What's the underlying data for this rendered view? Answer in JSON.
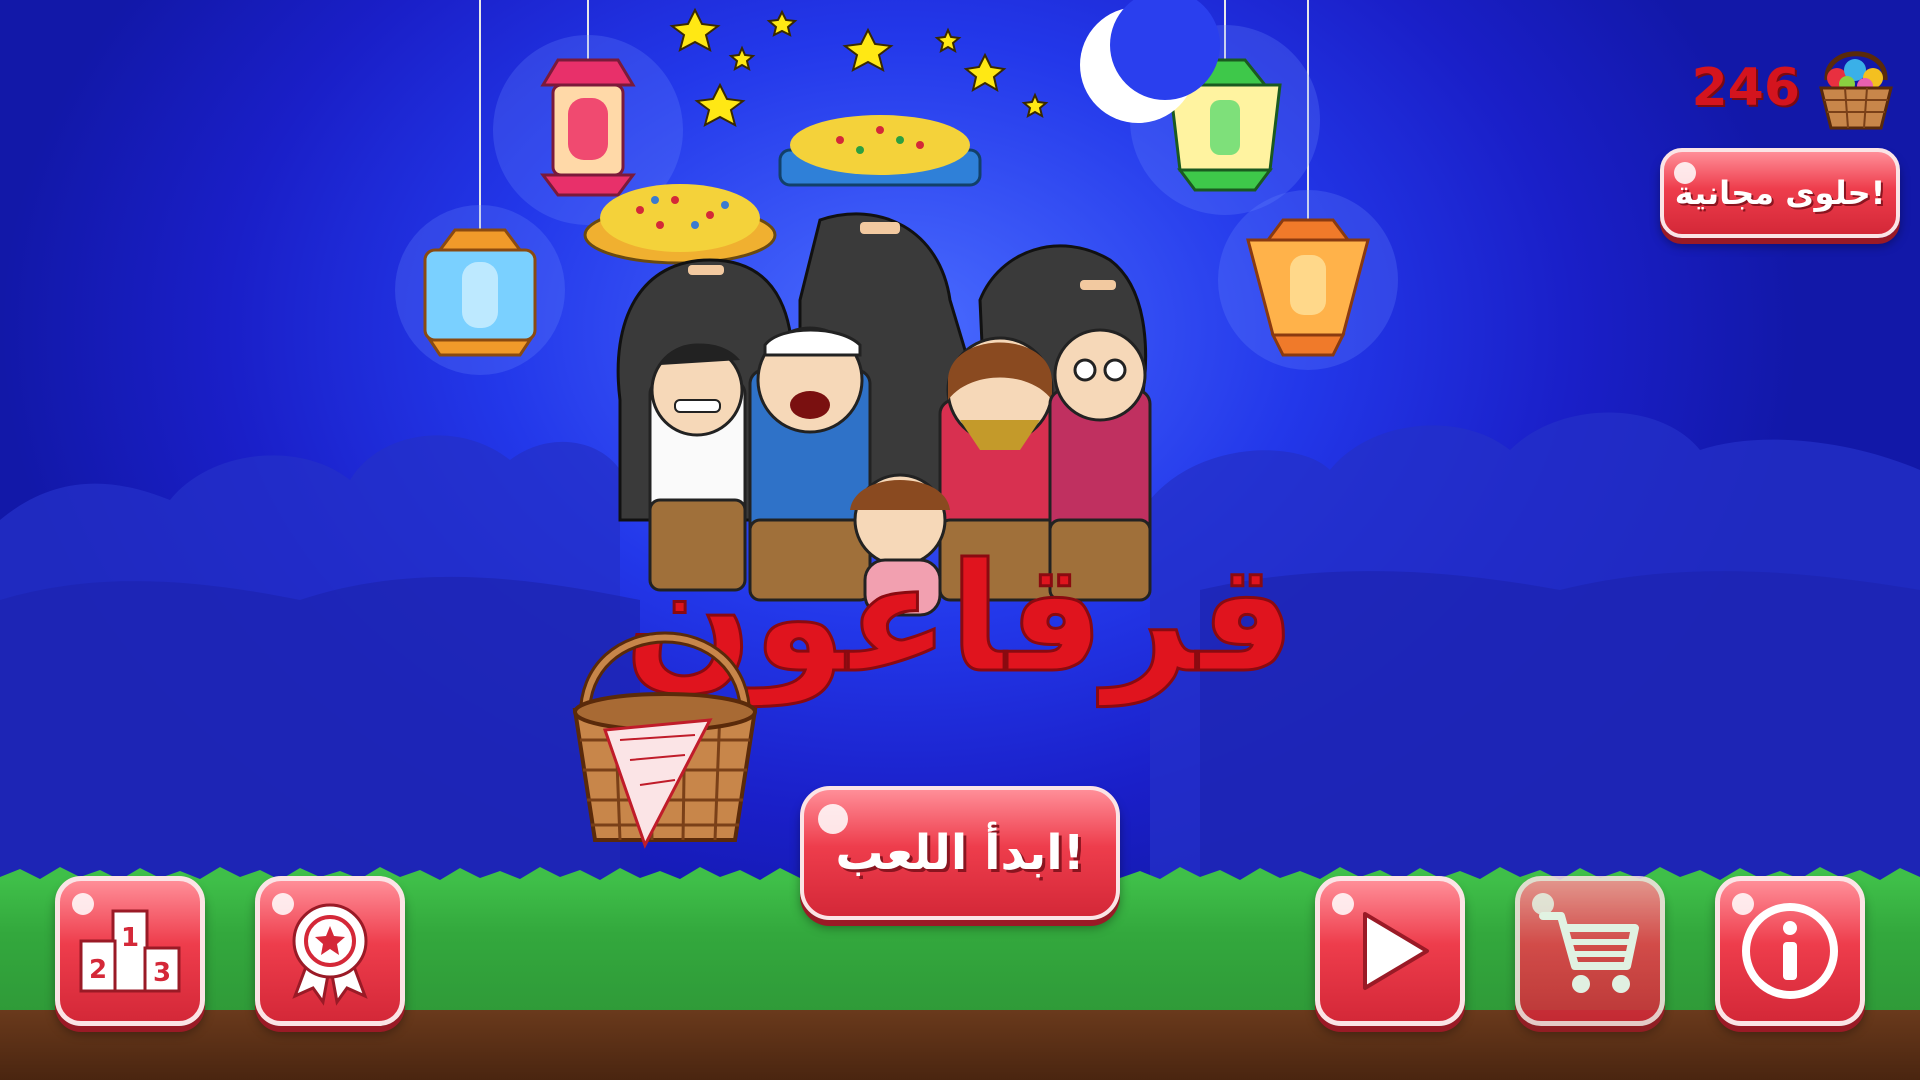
{
  "hud": {
    "candy_count": "246",
    "candy_icon": "candy-basket-icon"
  },
  "buttons": {
    "free_candy_label": "حلوى مجانية!",
    "start_label": "ابدأ اللعب!",
    "leaderboard_icon": "podium-icon",
    "achievements_icon": "award-ribbon-icon",
    "play_icon": "play-icon",
    "shop_icon": "cart-icon",
    "info_icon": "info-icon"
  },
  "podium_digits": [
    "1",
    "2",
    "3"
  ],
  "title_logo": "قرقاعون",
  "colors": {
    "sky": "#2338ea",
    "button_red": "#ee3d4c",
    "title_red": "#e0141e",
    "grass": "#33a83d",
    "dirt": "#4a2510"
  }
}
